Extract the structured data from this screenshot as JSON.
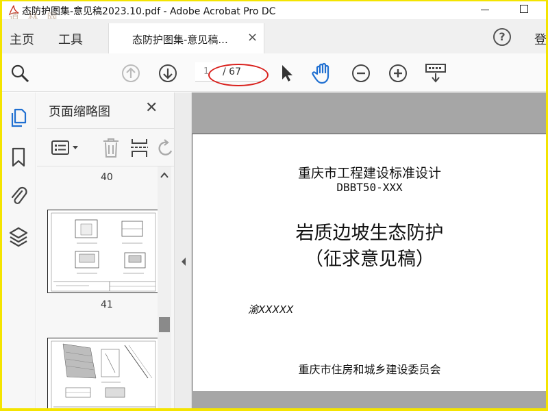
{
  "titlebar": {
    "title": "态防护图集-意见稿2023.10.pdf - Adobe Acrobat Pro DC",
    "watermark": "道 林 网"
  },
  "tabs": {
    "home": "主页",
    "tools": "工具",
    "document_tab": "态防护图集-意见稿...",
    "close_symbol": "×",
    "help_symbol": "?",
    "login_partial": "登"
  },
  "toolbar": {
    "page_current": "1",
    "page_total": "/ 67"
  },
  "thumbnail_panel": {
    "title": "页面缩略图",
    "close_symbol": "✕",
    "page_labels": [
      "40",
      "41"
    ]
  },
  "document": {
    "line1": "重庆市工程建设标准设计",
    "line2": "DBBT50-XXX",
    "line3": "岩质边坡生态防护",
    "line4": "（征求意见稿）",
    "code": "渝XXXXX",
    "line6": "重庆市住房和城乡建设委员会"
  },
  "colors": {
    "frame_border": "#f4e400",
    "accent_blue": "#1f6fd1",
    "annotation_red": "#d9201c",
    "viewport_gray": "#a6a6a6"
  },
  "icons": [
    "app-pdf-icon",
    "search-zoom-icon",
    "page-up-icon",
    "page-down-icon",
    "select-arrow-icon",
    "hand-tool-icon",
    "zoom-out-icon",
    "zoom-in-icon",
    "keyboard-scroll-icon",
    "pages-thumbnails-icon",
    "bookmark-icon",
    "attachment-icon",
    "layers-icon",
    "options-menu-icon",
    "delete-icon",
    "extract-pages-icon",
    "rotate-icon",
    "collapse-left-icon"
  ]
}
